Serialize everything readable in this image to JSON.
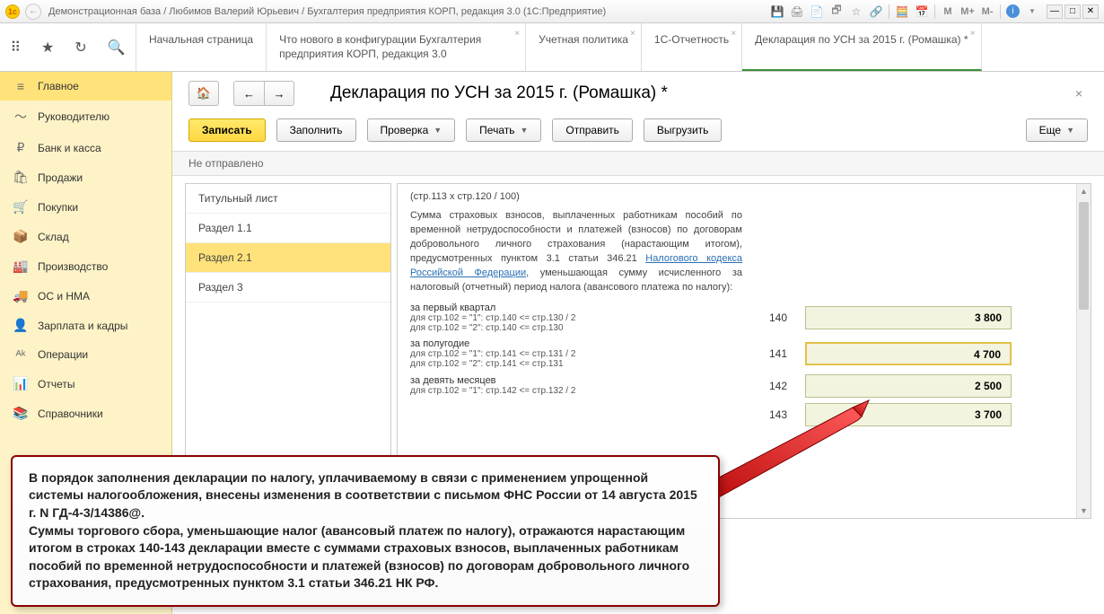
{
  "titlebar": {
    "title": "Демонстрационная база / Любимов Валерий Юрьевич / Бухгалтерия предприятия КОРП, редакция 3.0  (1С:Предприятие)",
    "m1": "M",
    "m2": "M+",
    "m3": "M-"
  },
  "tabs": {
    "t0": "Начальная страница",
    "t1": "Что нового в конфигурации Бухгалтерия предприятия КОРП, редакция 3.0",
    "t2": "Учетная политика",
    "t3": "1С-Отчетность",
    "t4": "Декларация по УСН за 2015 г. (Ромашка) *"
  },
  "sidebar": [
    {
      "icon": "≡",
      "label": "Главное"
    },
    {
      "icon": "〜",
      "label": "Руководителю"
    },
    {
      "icon": "₽",
      "label": "Банк и касса"
    },
    {
      "icon": "🛍",
      "label": "Продажи"
    },
    {
      "icon": "🛒",
      "label": "Покупки"
    },
    {
      "icon": "📦",
      "label": "Склад"
    },
    {
      "icon": "🏭",
      "label": "Производство"
    },
    {
      "icon": "🚚",
      "label": "ОС и НМА"
    },
    {
      "icon": "👤",
      "label": "Зарплата и кадры"
    },
    {
      "icon": "ᴬᵏ",
      "label": "Операции"
    },
    {
      "icon": "📊",
      "label": "Отчеты"
    },
    {
      "icon": "📚",
      "label": "Справочники"
    }
  ],
  "page": {
    "title": "Декларация по УСН за 2015 г. (Ромашка) *",
    "save": "Записать",
    "fill": "Заполнить",
    "check": "Проверка",
    "print": "Печать",
    "send": "Отправить",
    "export": "Выгрузить",
    "more": "Еще",
    "status": "Не отправлено"
  },
  "sections": [
    "Титульный лист",
    "Раздел 1.1",
    "Раздел 2.1",
    "Раздел 3"
  ],
  "form": {
    "top_hint": "(стр.113 x стр.120 / 100)",
    "para_pre": "Сумма страховых взносов, выплаченных работникам пособий по временной нетрудоспособности и платежей (взносов) по договорам добровольного личного страхования (нарастающим итогом), предусмотренных пунктом 3.1 статьи 346.21 ",
    "para_link": "Налогового кодекса Российской Федерации",
    "para_post": ", уменьшающая сумму исчисленного за налоговый (отчетный) период налога (авансового платежа по налогу):",
    "r140": {
      "label": "за первый квартал",
      "hint1": "для стр.102 = \"1\": стр.140 <= стр.130 / 2",
      "hint2": "для стр.102 = \"2\": стр.140 <= стр.130",
      "code": "140",
      "value": "3 800"
    },
    "r141": {
      "label": "за полугодие",
      "hint1": "для стр.102 = \"1\": стр.141 <= стр.131 / 2",
      "hint2": "для стр.102 = \"2\": стр.141 <= стр.131",
      "code": "141",
      "value": "4 700"
    },
    "r142": {
      "label": "за девять месяцев",
      "hint1": "для стр.102 = \"1\": стр.142 <= стр.132 / 2",
      "code": "142",
      "value": "2 500"
    },
    "r143": {
      "code": "143",
      "value": "3 700"
    }
  },
  "callout": {
    "text": "В порядок заполнения декларации по налогу, уплачиваемому в связи с применением упрощенной системы налогообложения, внесены изменения в соответствии с письмом ФНС России от 14 августа 2015 г. N ГД-4-3/14386@.\nСуммы торгового сбора, уменьшающие налог (авансовый платеж по налогу), отражаются нарастающим итогом в строках 140-143 декларации вместе с суммами страховых взносов, выплаченных работникам пособий по временной нетрудоспособности и платежей (взносов) по договорам добровольного личного страхования, предусмотренных пунктом 3.1 статьи 346.21 НК РФ."
  }
}
